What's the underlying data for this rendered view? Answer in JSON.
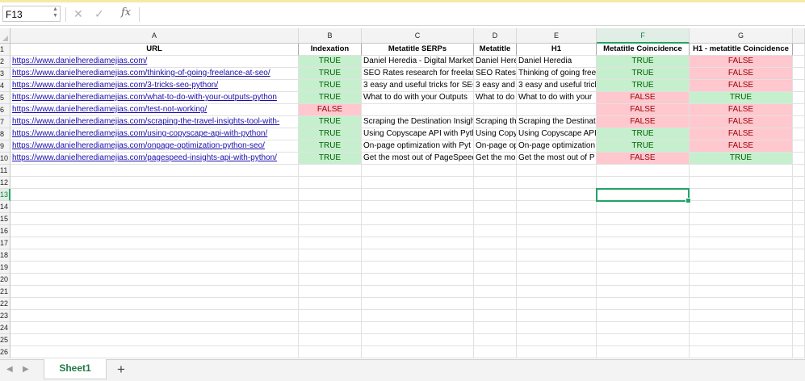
{
  "formula_bar": {
    "name_box": "F13",
    "formula": "",
    "fx_label": "fx"
  },
  "columns": [
    {
      "letter": "A",
      "w": 357,
      "selected": false
    },
    {
      "letter": "B",
      "w": 78,
      "selected": false
    },
    {
      "letter": "C",
      "w": 139,
      "selected": false
    },
    {
      "letter": "D",
      "w": 53,
      "selected": false
    },
    {
      "letter": "E",
      "w": 99,
      "selected": false
    },
    {
      "letter": "F",
      "w": 115,
      "selected": true
    },
    {
      "letter": "G",
      "w": 128,
      "selected": false
    }
  ],
  "rows": [
    {
      "num": "1",
      "cells": [
        {
          "text": "URL",
          "cls": "hdr"
        },
        {
          "text": "Indexation",
          "cls": "hdr"
        },
        {
          "text": "Metatitle SERPs",
          "cls": "hdr"
        },
        {
          "text": "Metatitle",
          "cls": "hdr"
        },
        {
          "text": "H1",
          "cls": "hdr"
        },
        {
          "text": "Metatitle Coincidence",
          "cls": "hdr"
        },
        {
          "text": "H1 - metatitle Coincidence",
          "cls": "hdr"
        }
      ]
    },
    {
      "num": "2",
      "cells": [
        {
          "text": "https://www.danielherediamejias.com/",
          "cls": "link"
        },
        {
          "text": "TRUE",
          "cls": "c t"
        },
        {
          "text": "Daniel Heredia - Digital Market",
          "cls": ""
        },
        {
          "text": "Daniel Here",
          "cls": ""
        },
        {
          "text": "Daniel Heredia",
          "cls": ""
        },
        {
          "text": "TRUE",
          "cls": "c t"
        },
        {
          "text": "FALSE",
          "cls": "c f"
        }
      ]
    },
    {
      "num": "3",
      "cells": [
        {
          "text": "https://www.danielherediamejias.com/thinking-of-going-freelance-at-seo/",
          "cls": "link"
        },
        {
          "text": "TRUE",
          "cls": "c t"
        },
        {
          "text": "SEO Rates research for freelance",
          "cls": ""
        },
        {
          "text": "SEO Rates re",
          "cls": ""
        },
        {
          "text": "Thinking of going free",
          "cls": ""
        },
        {
          "text": "TRUE",
          "cls": "c t"
        },
        {
          "text": "FALSE",
          "cls": "c f"
        }
      ]
    },
    {
      "num": "4",
      "cells": [
        {
          "text": "https://www.danielherediamejias.com/3-tricks-seo-python/",
          "cls": "link"
        },
        {
          "text": "TRUE",
          "cls": "c t"
        },
        {
          "text": "3 easy and useful tricks for SEO",
          "cls": ""
        },
        {
          "text": "3 easy and u",
          "cls": ""
        },
        {
          "text": "3 easy and useful trick",
          "cls": ""
        },
        {
          "text": "TRUE",
          "cls": "c t"
        },
        {
          "text": "FALSE",
          "cls": "c f"
        }
      ]
    },
    {
      "num": "5",
      "cells": [
        {
          "text": "https://www.danielherediamejias.com/what-to-do-with-your-outputs-python",
          "cls": "link"
        },
        {
          "text": "TRUE",
          "cls": "c t"
        },
        {
          "text": "What to do with your Outputs",
          "cls": ""
        },
        {
          "text": "What to do",
          "cls": ""
        },
        {
          "text": "What to do with your",
          "cls": ""
        },
        {
          "text": "FALSE",
          "cls": "c f"
        },
        {
          "text": "TRUE",
          "cls": "c t"
        }
      ]
    },
    {
      "num": "6",
      "cells": [
        {
          "text": "https://www.danielherediamejias.com/test-not-working/",
          "cls": "link"
        },
        {
          "text": "FALSE",
          "cls": "c f"
        },
        {
          "text": "",
          "cls": ""
        },
        {
          "text": "",
          "cls": ""
        },
        {
          "text": "",
          "cls": ""
        },
        {
          "text": "FALSE",
          "cls": "c f"
        },
        {
          "text": "FALSE",
          "cls": "c f"
        }
      ]
    },
    {
      "num": "7",
      "cells": [
        {
          "text": "https://www.danielherediamejias.com/scraping-the-travel-insights-tool-with-",
          "cls": "link"
        },
        {
          "text": "TRUE",
          "cls": "c t"
        },
        {
          "text": "Scraping the Destination Insigh",
          "cls": ""
        },
        {
          "text": "Scraping th",
          "cls": ""
        },
        {
          "text": "Scraping the Destinat",
          "cls": ""
        },
        {
          "text": "FALSE",
          "cls": "c f"
        },
        {
          "text": "FALSE",
          "cls": "c f"
        }
      ]
    },
    {
      "num": "8",
      "cells": [
        {
          "text": "https://www.danielherediamejias.com/using-copyscape-api-with-python/",
          "cls": "link"
        },
        {
          "text": "TRUE",
          "cls": "c t"
        },
        {
          "text": "Using Copyscape API with Pyth",
          "cls": ""
        },
        {
          "text": "Using Copy",
          "cls": ""
        },
        {
          "text": "Using Copyscape API w",
          "cls": ""
        },
        {
          "text": "TRUE",
          "cls": "c t"
        },
        {
          "text": "FALSE",
          "cls": "c f"
        }
      ]
    },
    {
      "num": "9",
      "cells": [
        {
          "text": "https://www.danielherediamejias.com/onpage-optimization-python-seo/",
          "cls": "link"
        },
        {
          "text": "TRUE",
          "cls": "c t"
        },
        {
          "text": "On-page optimization with Pyt",
          "cls": ""
        },
        {
          "text": "On-page op",
          "cls": ""
        },
        {
          "text": "On-page optimization",
          "cls": ""
        },
        {
          "text": "TRUE",
          "cls": "c t"
        },
        {
          "text": "FALSE",
          "cls": "c f"
        }
      ]
    },
    {
      "num": "10",
      "cells": [
        {
          "text": "https://www.danielherediamejias.com/pagespeed-insights-api-with-python/",
          "cls": "link"
        },
        {
          "text": "TRUE",
          "cls": "c t"
        },
        {
          "text": "Get the most out of PageSpeed",
          "cls": ""
        },
        {
          "text": "Get the mo",
          "cls": ""
        },
        {
          "text": "Get the most out of P",
          "cls": ""
        },
        {
          "text": "FALSE",
          "cls": "c f"
        },
        {
          "text": "TRUE",
          "cls": "c t"
        }
      ]
    },
    {
      "num": "11",
      "cells": []
    },
    {
      "num": "12",
      "cells": []
    },
    {
      "num": "13",
      "cells": [],
      "selected": true
    },
    {
      "num": "14",
      "cells": []
    },
    {
      "num": "15",
      "cells": []
    },
    {
      "num": "16",
      "cells": []
    },
    {
      "num": "17",
      "cells": []
    },
    {
      "num": "18",
      "cells": []
    },
    {
      "num": "19",
      "cells": []
    },
    {
      "num": "20",
      "cells": []
    },
    {
      "num": "21",
      "cells": []
    },
    {
      "num": "22",
      "cells": []
    },
    {
      "num": "23",
      "cells": []
    },
    {
      "num": "24",
      "cells": []
    },
    {
      "num": "25",
      "cells": []
    },
    {
      "num": "26",
      "cells": []
    }
  ],
  "selected_cell": {
    "col": 5,
    "row": 12
  },
  "sheet_tabs": [
    {
      "label": "Sheet1",
      "active": true
    }
  ],
  "add_sheet_label": "+",
  "colors": {
    "true_bg": "#c6efce",
    "false_bg": "#ffc7ce",
    "accent": "#21a366",
    "link": "#1a0dab"
  }
}
